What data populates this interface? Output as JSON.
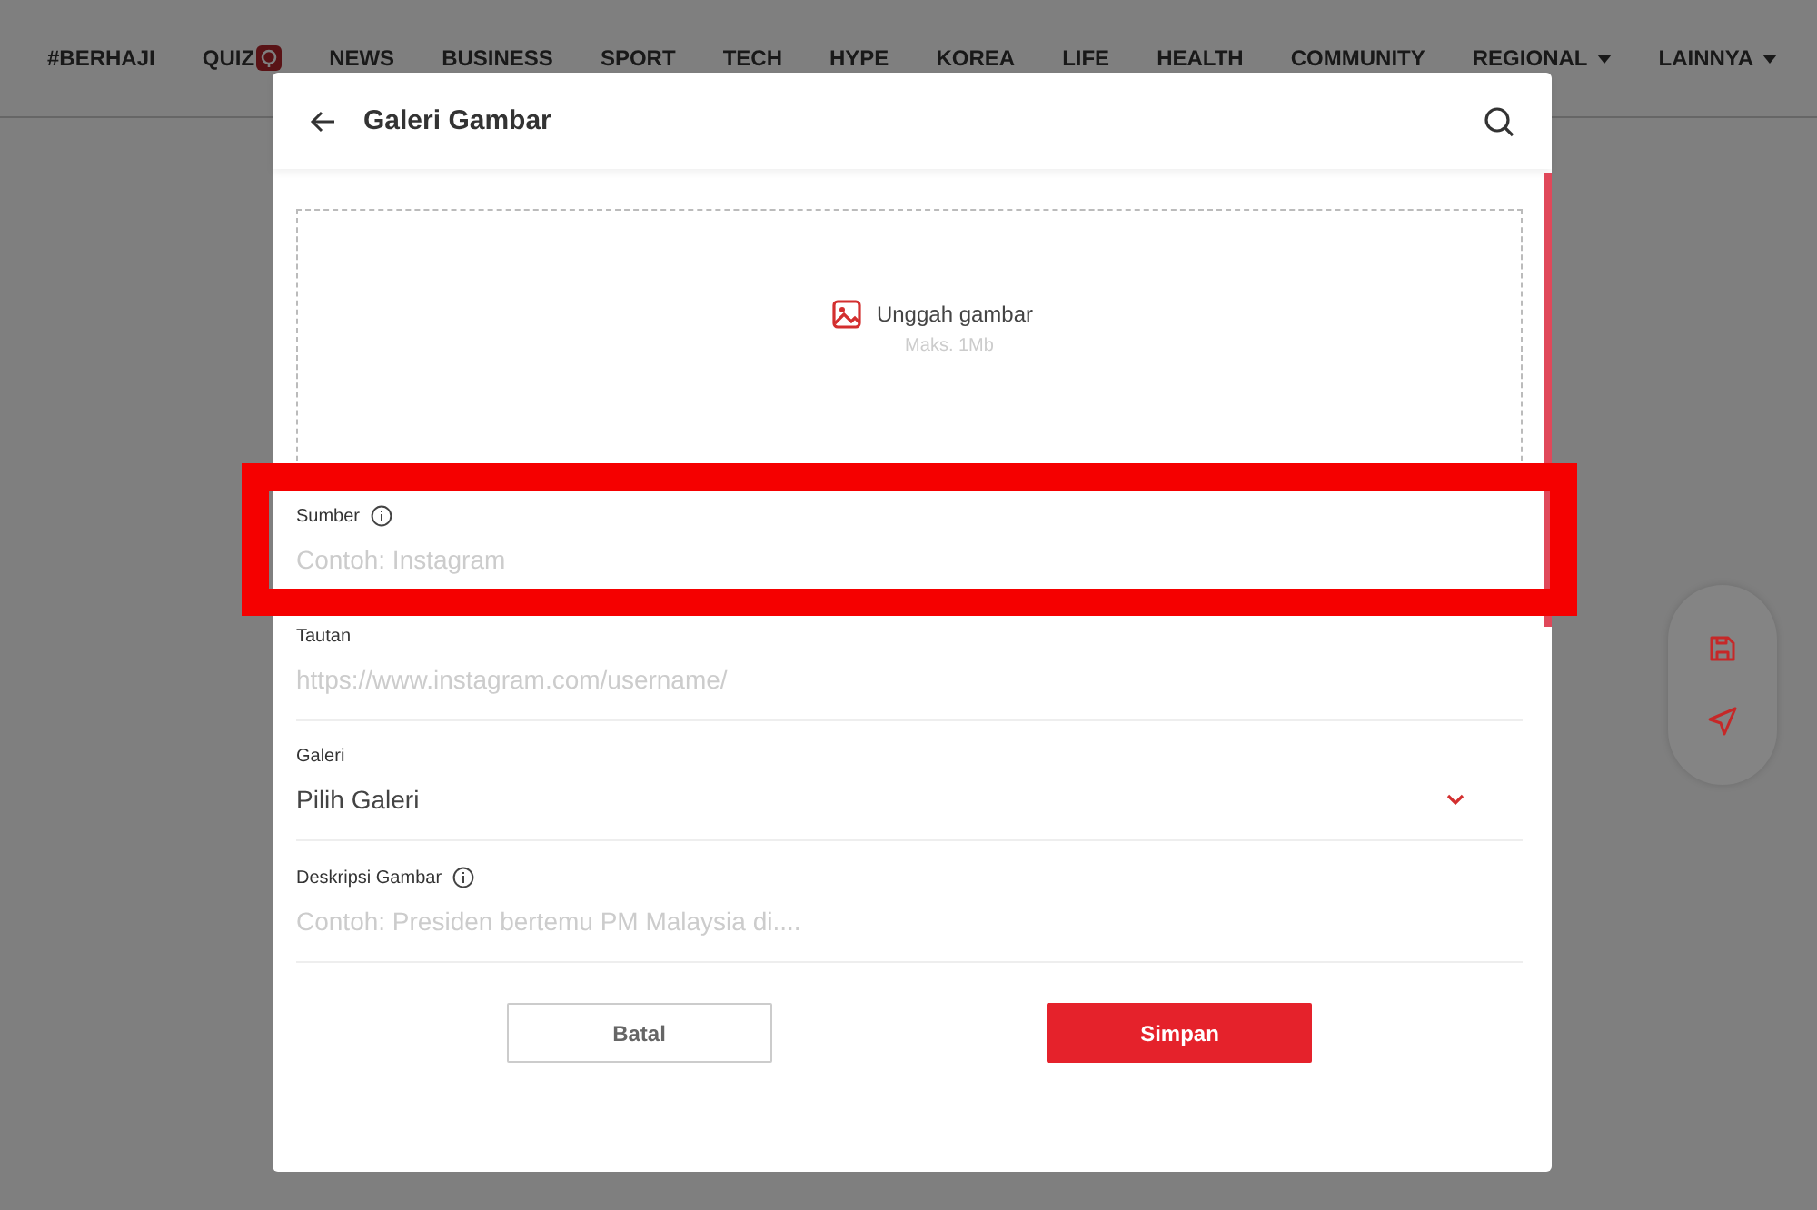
{
  "nav": [
    {
      "label": "#BERHAJI",
      "kind": "plain"
    },
    {
      "label": "QUIZ",
      "kind": "badge"
    },
    {
      "label": "NEWS",
      "kind": "plain"
    },
    {
      "label": "BUSINESS",
      "kind": "plain"
    },
    {
      "label": "SPORT",
      "kind": "plain"
    },
    {
      "label": "TECH",
      "kind": "plain"
    },
    {
      "label": "HYPE",
      "kind": "plain"
    },
    {
      "label": "KOREA",
      "kind": "plain"
    },
    {
      "label": "LIFE",
      "kind": "plain"
    },
    {
      "label": "HEALTH",
      "kind": "plain"
    },
    {
      "label": "COMMUNITY",
      "kind": "plain"
    },
    {
      "label": "REGIONAL",
      "kind": "dropdown"
    },
    {
      "label": "LAINNYA",
      "kind": "dropdown"
    }
  ],
  "modal": {
    "title": "Galeri Gambar",
    "upload": {
      "label": "Unggah gambar",
      "hint": "Maks. 1Mb"
    },
    "fields": [
      {
        "label": "Sumber",
        "kind": "text",
        "info": true,
        "placeholder": "Contoh: Instagram",
        "highlighted": true
      },
      {
        "label": "Tautan",
        "kind": "text",
        "info": false,
        "placeholder": "https://www.instagram.com/username/",
        "highlighted": false
      },
      {
        "label": "Galeri",
        "kind": "select",
        "info": false,
        "value": "Pilih Galeri",
        "highlighted": false
      },
      {
        "label": "Deskripsi Gambar",
        "kind": "text",
        "info": true,
        "placeholder": "Contoh: Presiden bertemu PM Malaysia di....",
        "highlighted": false
      }
    ],
    "buttons": [
      {
        "label": "Batal",
        "kind": "secondary"
      },
      {
        "label": "Simpan",
        "kind": "primary"
      }
    ]
  }
}
